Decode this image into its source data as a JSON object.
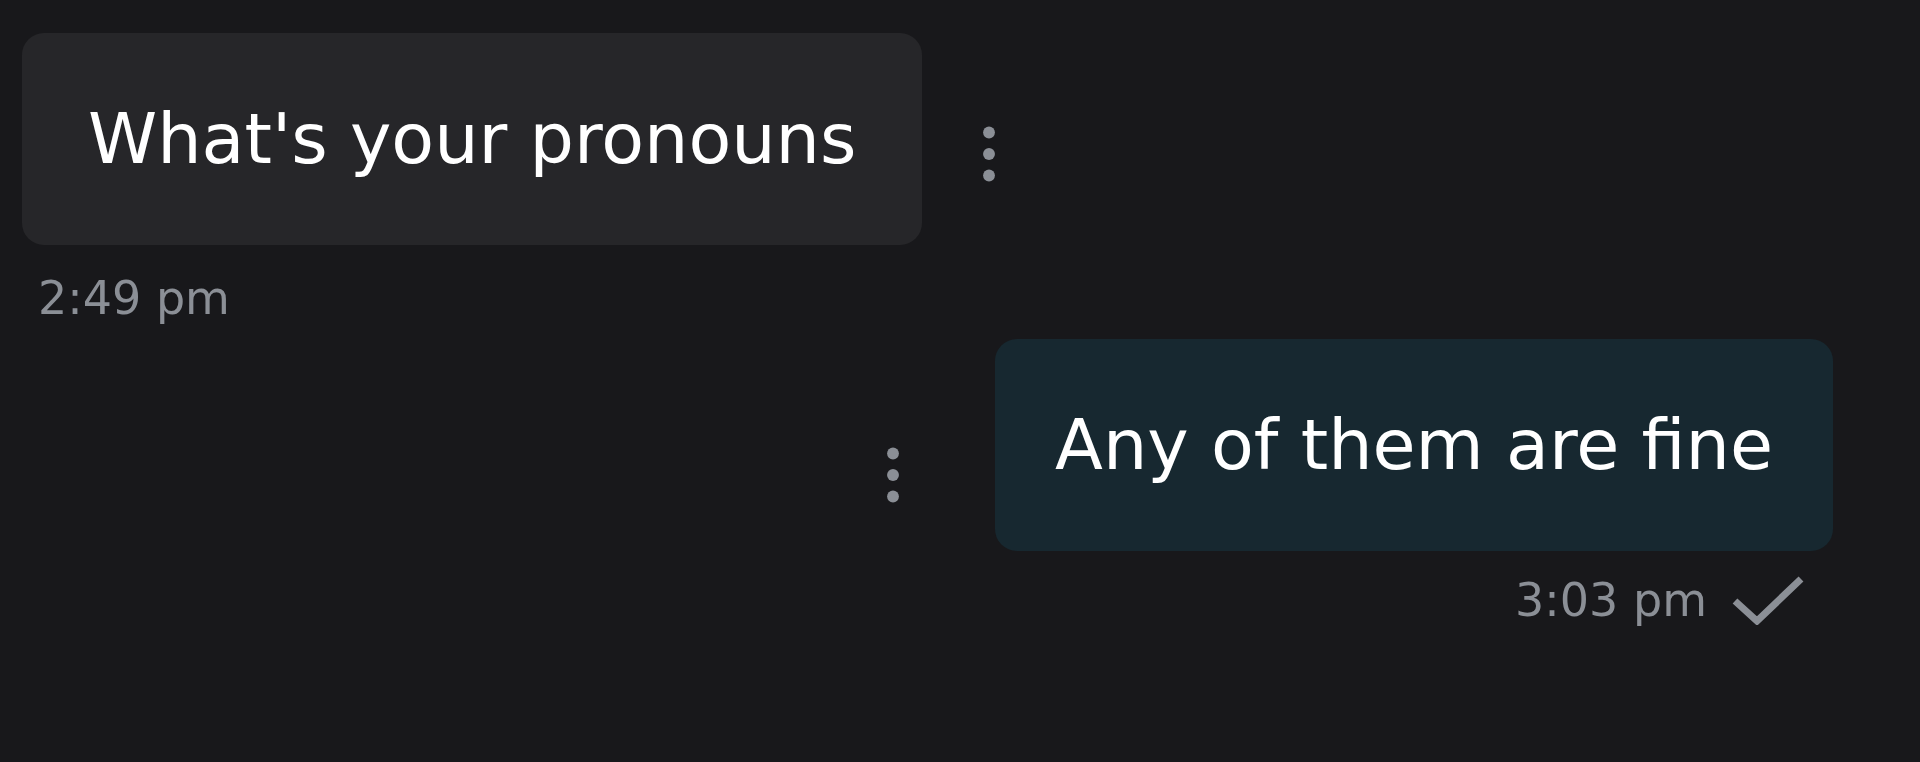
{
  "messages": [
    {
      "kind": "incoming",
      "text": "What's your pronouns",
      "time": "2:49 pm"
    },
    {
      "kind": "outgoing",
      "text": "Any of them are fine",
      "time": "3:03 pm",
      "sent": true
    }
  ]
}
